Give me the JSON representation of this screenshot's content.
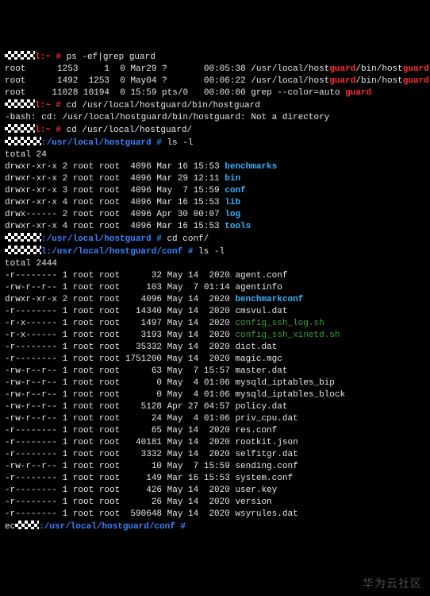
{
  "cmd1": {
    "prompt_text": "l:~ # ",
    "cmd": "ps -ef|grep guard"
  },
  "ps": [
    {
      "user": "root",
      "pid": "1253",
      "ppid": "1",
      "c": "0",
      "stime": "Mar29",
      "tty": "?",
      "time": "00:05:38",
      "path": "/usr/local/host",
      "hl1": "guard",
      "mid": "/bin/host",
      "hl2": "guard"
    },
    {
      "user": "root",
      "pid": "1492",
      "ppid": "1253",
      "c": "0",
      "stime": "May04",
      "tty": "?",
      "time": "00:06:22",
      "path": "/usr/local/host",
      "hl1": "guard",
      "mid": "/bin/host",
      "hl2": "guard"
    },
    {
      "user": "root",
      "pid": "11028",
      "ppid": "10194",
      "c": "0",
      "stime": "15:59",
      "tty": "pts/0",
      "time": "00:00:00",
      "greptxt": "grep --color=auto ",
      "hl": "guard"
    }
  ],
  "cmd2": {
    "prompt_text": "l:~ # ",
    "cmd": "cd /usr/local/hostguard/bin/hostguard"
  },
  "err": "-bash: cd: /usr/local/hostguard/bin/hostguard: Not a directory",
  "cmd3": {
    "prompt_text": "l:~ # ",
    "cmd": "cd /usr/local/hostguard/"
  },
  "cmd4": {
    "prompt_path": ":/usr/local/hostguard # ",
    "cmd": "ls -l"
  },
  "tot1": "total 24",
  "ls1": [
    {
      "perm": "drwxr-xr-x",
      "n": "2",
      "u": "root",
      "g": "root",
      "size": "4096",
      "date": "Mar 16 15:53",
      "name": "benchmarks",
      "cls": "cyan"
    },
    {
      "perm": "drwxr-xr-x",
      "n": "2",
      "u": "root",
      "g": "root",
      "size": "4096",
      "date": "Mar 29 12:11",
      "name": "bin",
      "cls": "cyan"
    },
    {
      "perm": "drwxr-xr-x",
      "n": "3",
      "u": "root",
      "g": "root",
      "size": "4096",
      "date": "May  7 15:59",
      "name": "conf",
      "cls": "cyan"
    },
    {
      "perm": "drwxr-xr-x",
      "n": "4",
      "u": "root",
      "g": "root",
      "size": "4096",
      "date": "Mar 16 15:53",
      "name": "lib",
      "cls": "cyan"
    },
    {
      "perm": "drwx------",
      "n": "2",
      "u": "root",
      "g": "root",
      "size": "4096",
      "date": "Apr 30 00:07",
      "name": "log",
      "cls": "cyan"
    },
    {
      "perm": "drwxr-xr-x",
      "n": "4",
      "u": "root",
      "g": "root",
      "size": "4096",
      "date": "Mar 16 15:53",
      "name": "tools",
      "cls": "cyan"
    }
  ],
  "cmd5": {
    "prompt_path": ":/usr/local/hostguard # ",
    "cmd": "cd conf/"
  },
  "cmd6": {
    "prompt_path": "l:/usr/local/hostguard/conf # ",
    "cmd": "ls -l"
  },
  "tot2": "total 2444",
  "ls2": [
    {
      "perm": "-r--------",
      "n": "1",
      "u": "root",
      "g": "root",
      "size": "32",
      "date": "May 14  2020",
      "name": "agent.conf",
      "cls": "white"
    },
    {
      "perm": "-rw-r--r--",
      "n": "1",
      "u": "root",
      "g": "root",
      "size": "103",
      "date": "May  7 01:14",
      "name": "agentinfo",
      "cls": "white"
    },
    {
      "perm": "drwxr-xr-x",
      "n": "2",
      "u": "root",
      "g": "root",
      "size": "4096",
      "date": "May 14  2020",
      "name": "benchmarkconf",
      "cls": "cyan"
    },
    {
      "perm": "-r--------",
      "n": "1",
      "u": "root",
      "g": "root",
      "size": "14340",
      "date": "May 14  2020",
      "name": "cmsvul.dat",
      "cls": "white"
    },
    {
      "perm": "-r-x------",
      "n": "1",
      "u": "root",
      "g": "root",
      "size": "1497",
      "date": "May 14  2020",
      "name": "config_ssh_log.sh",
      "cls": "green"
    },
    {
      "perm": "-r-x------",
      "n": "1",
      "u": "root",
      "g": "root",
      "size": "3193",
      "date": "May 14  2020",
      "name": "config_ssh_xinetd.sh",
      "cls": "green"
    },
    {
      "perm": "-r--------",
      "n": "1",
      "u": "root",
      "g": "root",
      "size": "35332",
      "date": "May 14  2020",
      "name": "dict.dat",
      "cls": "white"
    },
    {
      "perm": "-r--------",
      "n": "1",
      "u": "root",
      "g": "root",
      "size": "1751200",
      "date": "May 14  2020",
      "name": "magic.mgc",
      "cls": "white"
    },
    {
      "perm": "-rw-r--r--",
      "n": "1",
      "u": "root",
      "g": "root",
      "size": "63",
      "date": "May  7 15:57",
      "name": "master.dat",
      "cls": "white"
    },
    {
      "perm": "-rw-r--r--",
      "n": "1",
      "u": "root",
      "g": "root",
      "size": "0",
      "date": "May  4 01:06",
      "name": "mysqld_iptables_bip",
      "cls": "white"
    },
    {
      "perm": "-rw-r--r--",
      "n": "1",
      "u": "root",
      "g": "root",
      "size": "0",
      "date": "May  4 01:06",
      "name": "mysqld_iptables_block",
      "cls": "white"
    },
    {
      "perm": "-rw-r--r--",
      "n": "1",
      "u": "root",
      "g": "root",
      "size": "5128",
      "date": "Apr 27 04:57",
      "name": "policy.dat",
      "cls": "white"
    },
    {
      "perm": "-rw-r--r--",
      "n": "1",
      "u": "root",
      "g": "root",
      "size": "24",
      "date": "May  4 01:06",
      "name": "priv_cpu.dat",
      "cls": "white"
    },
    {
      "perm": "-r--------",
      "n": "1",
      "u": "root",
      "g": "root",
      "size": "65",
      "date": "May 14  2020",
      "name": "res.conf",
      "cls": "white"
    },
    {
      "perm": "-r--------",
      "n": "1",
      "u": "root",
      "g": "root",
      "size": "40181",
      "date": "May 14  2020",
      "name": "rootkit.json",
      "cls": "white"
    },
    {
      "perm": "-r--------",
      "n": "1",
      "u": "root",
      "g": "root",
      "size": "3332",
      "date": "May 14  2020",
      "name": "selfitgr.dat",
      "cls": "white"
    },
    {
      "perm": "-rw-r--r--",
      "n": "1",
      "u": "root",
      "g": "root",
      "size": "10",
      "date": "May  7 15:59",
      "name": "sending.conf",
      "cls": "white"
    },
    {
      "perm": "-r--------",
      "n": "1",
      "u": "root",
      "g": "root",
      "size": "149",
      "date": "Mar 16 15:53",
      "name": "system.conf",
      "cls": "white"
    },
    {
      "perm": "-r--------",
      "n": "1",
      "u": "root",
      "g": "root",
      "size": "426",
      "date": "May 14  2020",
      "name": "user.key",
      "cls": "white"
    },
    {
      "perm": "-r--------",
      "n": "1",
      "u": "root",
      "g": "root",
      "size": "26",
      "date": "May 14  2020",
      "name": "version",
      "cls": "white"
    },
    {
      "perm": "-r--------",
      "n": "1",
      "u": "root",
      "g": "root",
      "size": "590648",
      "date": "May 14  2020",
      "name": "wsyrules.dat",
      "cls": "white"
    }
  ],
  "last": {
    "pre": "ec",
    "prompt_path": ":/usr/local/hostguard/conf # "
  },
  "watermark": "华为云社区"
}
